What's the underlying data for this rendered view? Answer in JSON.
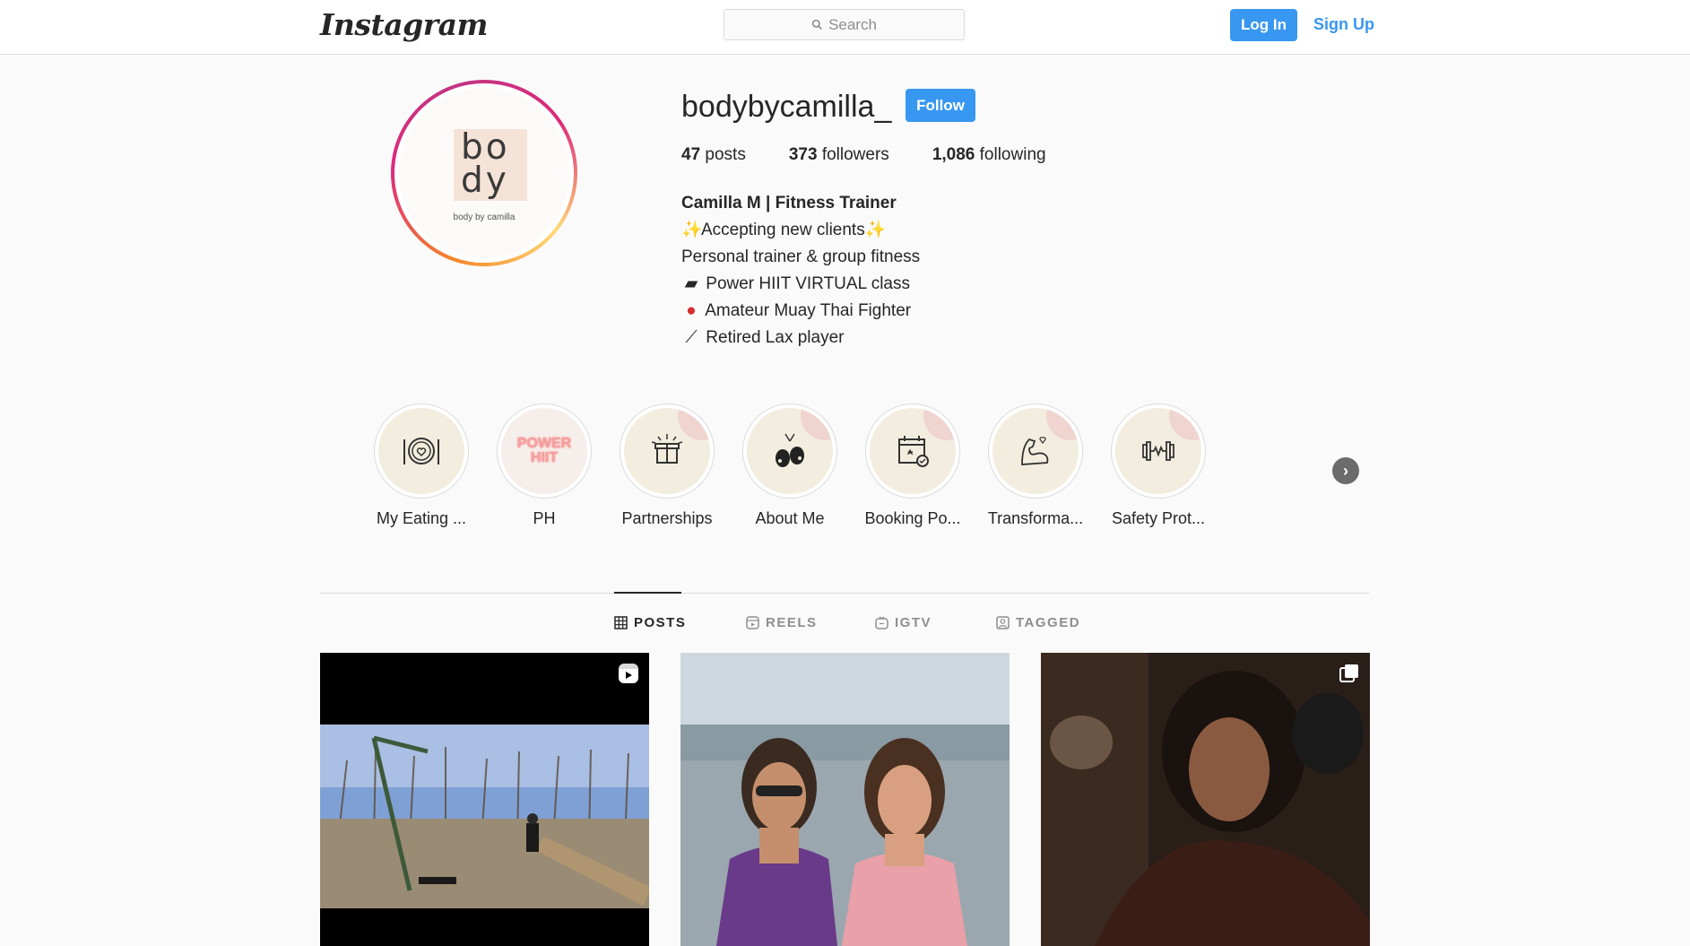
{
  "header": {
    "logo": "Instagram",
    "search_placeholder": "Search",
    "login_label": "Log In",
    "signup_label": "Sign Up"
  },
  "profile": {
    "avatar_text": "bo dy",
    "avatar_caption": "body by camilla",
    "username": "bodybycamilla_",
    "follow_label": "Follow",
    "stats": {
      "posts_count": "47",
      "posts_label": "posts",
      "followers_count": "373",
      "followers_label": "followers",
      "following_count": "1,086",
      "following_label": "following"
    },
    "bio": {
      "name": "Camilla M | Fitness Trainer",
      "line1": "Accepting new clients",
      "line2": "Personal trainer & group fitness",
      "line3": "Power HIIT VIRTUAL class",
      "line4": "Amateur Muay Thai Fighter",
      "line5": "Retired Lax player"
    }
  },
  "highlights": [
    {
      "label": "My Eating ...",
      "icon": "plate-icon"
    },
    {
      "label": "PH",
      "icon": "power-hiit-icon",
      "art_text": "POWER HIIT"
    },
    {
      "label": "Partnerships",
      "icon": "gift-icon"
    },
    {
      "label": "About Me",
      "icon": "boxing-gloves-icon"
    },
    {
      "label": "Booking Po...",
      "icon": "calendar-icon"
    },
    {
      "label": "Transforma...",
      "icon": "flexed-arm-icon"
    },
    {
      "label": "Safety Prot...",
      "icon": "dumbbell-icon"
    }
  ],
  "tabs": [
    {
      "label": "POSTS",
      "icon": "grid-icon",
      "active": true
    },
    {
      "label": "REELS",
      "icon": "reels-icon",
      "active": false
    },
    {
      "label": "IGTV",
      "icon": "igtv-icon",
      "active": false
    },
    {
      "label": "TAGGED",
      "icon": "tagged-icon",
      "active": false
    }
  ],
  "posts": [
    {
      "type": "reel",
      "badge": "reel-icon"
    },
    {
      "type": "photo"
    },
    {
      "type": "carousel",
      "badge": "carousel-icon"
    }
  ],
  "colors": {
    "accent": "#3897f0",
    "text": "#262626",
    "muted": "#8e8e8e",
    "border": "#dbdbdb",
    "background": "#fafafa"
  }
}
